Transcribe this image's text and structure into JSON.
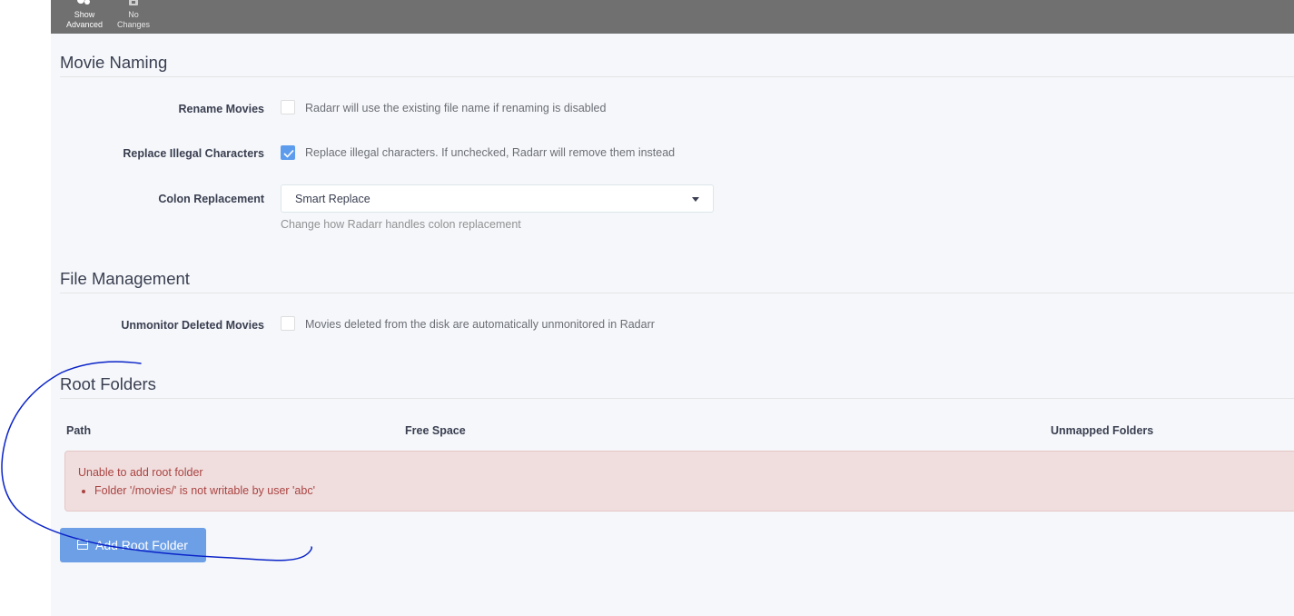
{
  "toolbar": {
    "show_advanced": {
      "line1": "Show",
      "line2": "Advanced",
      "icon": "gear-icon"
    },
    "no_changes": {
      "line1": "No",
      "line2": "Changes",
      "icon": "save-icon"
    }
  },
  "movie_naming": {
    "title": "Movie Naming",
    "rename_movies": {
      "label": "Rename Movies",
      "checked": false,
      "help": "Radarr will use the existing file name if renaming is disabled"
    },
    "replace_illegal": {
      "label": "Replace Illegal Characters",
      "checked": true,
      "help": "Replace illegal characters. If unchecked, Radarr will remove them instead"
    },
    "colon_replacement": {
      "label": "Colon Replacement",
      "value": "Smart Replace",
      "help": "Change how Radarr handles colon replacement"
    }
  },
  "file_management": {
    "title": "File Management",
    "unmonitor_deleted": {
      "label": "Unmonitor Deleted Movies",
      "checked": false,
      "help": "Movies deleted from the disk are automatically unmonitored in Radarr"
    }
  },
  "root_folders": {
    "title": "Root Folders",
    "columns": [
      "Path",
      "Free Space",
      "Unmapped Folders"
    ],
    "error": {
      "message": "Unable to add root folder",
      "items": [
        "Folder '/movies/' is not writable by user 'abc'"
      ]
    },
    "add_button": "Add Root Folder"
  },
  "colors": {
    "toolbar": "#707070",
    "accent": "#5d9cec",
    "error_bg": "#f0dede",
    "error_text": "#a94442",
    "annotation_ink": "#0a23c8"
  }
}
